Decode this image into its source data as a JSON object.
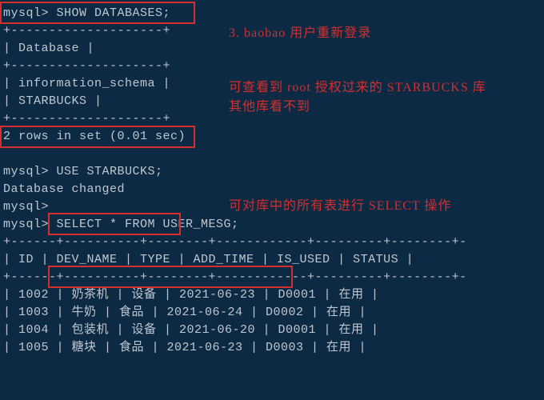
{
  "terminal": {
    "prompt": "mysql>",
    "cmd_show_db": "mysql> SHOW DATABASES;",
    "db_border": "+--------------------+",
    "db_header": "| Database           |",
    "db_row1": "| information_schema |",
    "db_row2": "| STARBUCKS          |",
    "result_rows": "2 rows in set (0.01 sec)",
    "blank": " ",
    "cmd_use": "mysql> USE STARBUCKS;",
    "db_changed": "Database changed",
    "cmd_select": "mysql> SELECT * FROM USER_MESG;",
    "table_border": "+------+----------+--------+------------+---------+--------+-",
    "table_header": "| ID   | DEV_NAME | TYPE   | ADD_TIME   | IS_USED | STATUS |",
    "rows": [
      "| 1002 | 奶茶机   | 设备   | 2021-06-23 | D0001   | 在用   |",
      "| 1003 | 牛奶     | 食品   | 2021-06-24 | D0002   | 在用   |",
      "| 1004 | 包装机   | 设备   | 2021-06-20 | D0001   | 在用   |",
      "| 1005 | 糖块     | 食品   | 2021-06-23 | D0003   | 在用   |"
    ]
  },
  "annotations": {
    "a1": "3. baobao 用户重新登录",
    "a2": "可查看到  root 授权过来的 STARBUCKS 库",
    "a2b": "其他库看不到",
    "a3": "可对库中的所有表进行 SELECT 操作"
  }
}
